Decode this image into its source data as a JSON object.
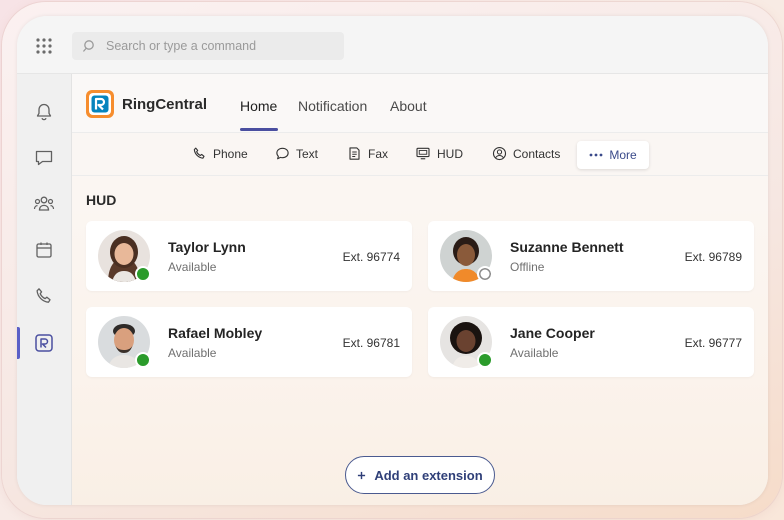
{
  "search": {
    "placeholder": "Search or type a command"
  },
  "sidebar": {
    "items": [
      {
        "icon": "bell-icon"
      },
      {
        "icon": "chat-icon"
      },
      {
        "icon": "teams-icon"
      },
      {
        "icon": "calendar-icon"
      },
      {
        "icon": "phone-icon"
      },
      {
        "icon": "ringcentral-icon",
        "active": true
      }
    ]
  },
  "app": {
    "brand": "RingCentral",
    "tabs": [
      {
        "label": "Home",
        "active": true
      },
      {
        "label": "Notification"
      },
      {
        "label": "About"
      }
    ]
  },
  "subnav": {
    "items": [
      {
        "label": "Phone",
        "icon": "phone-icon"
      },
      {
        "label": "Text",
        "icon": "text-bubble-icon"
      },
      {
        "label": "Fax",
        "icon": "fax-icon"
      },
      {
        "label": "HUD",
        "icon": "monitor-icon"
      },
      {
        "label": "Contacts",
        "icon": "contact-icon"
      }
    ],
    "more": "More"
  },
  "hud": {
    "title": "HUD",
    "contacts": [
      {
        "name": "Taylor Lynn",
        "status": "Available",
        "ext": "Ext. 96774"
      },
      {
        "name": "Suzanne Bennett",
        "status": "Offline",
        "ext": "Ext. 96789"
      },
      {
        "name": "Rafael Mobley",
        "status": "Available",
        "ext": "Ext. 96781"
      },
      {
        "name": "Jane Cooper",
        "status": "Available",
        "ext": "Ext. 96777"
      }
    ],
    "add_button": "Add an extension"
  },
  "colors": {
    "accent": "#4a4fa0",
    "available": "#2b9b2b",
    "brand_blue": "#0684bd",
    "brand_orange": "#f68d2e"
  }
}
